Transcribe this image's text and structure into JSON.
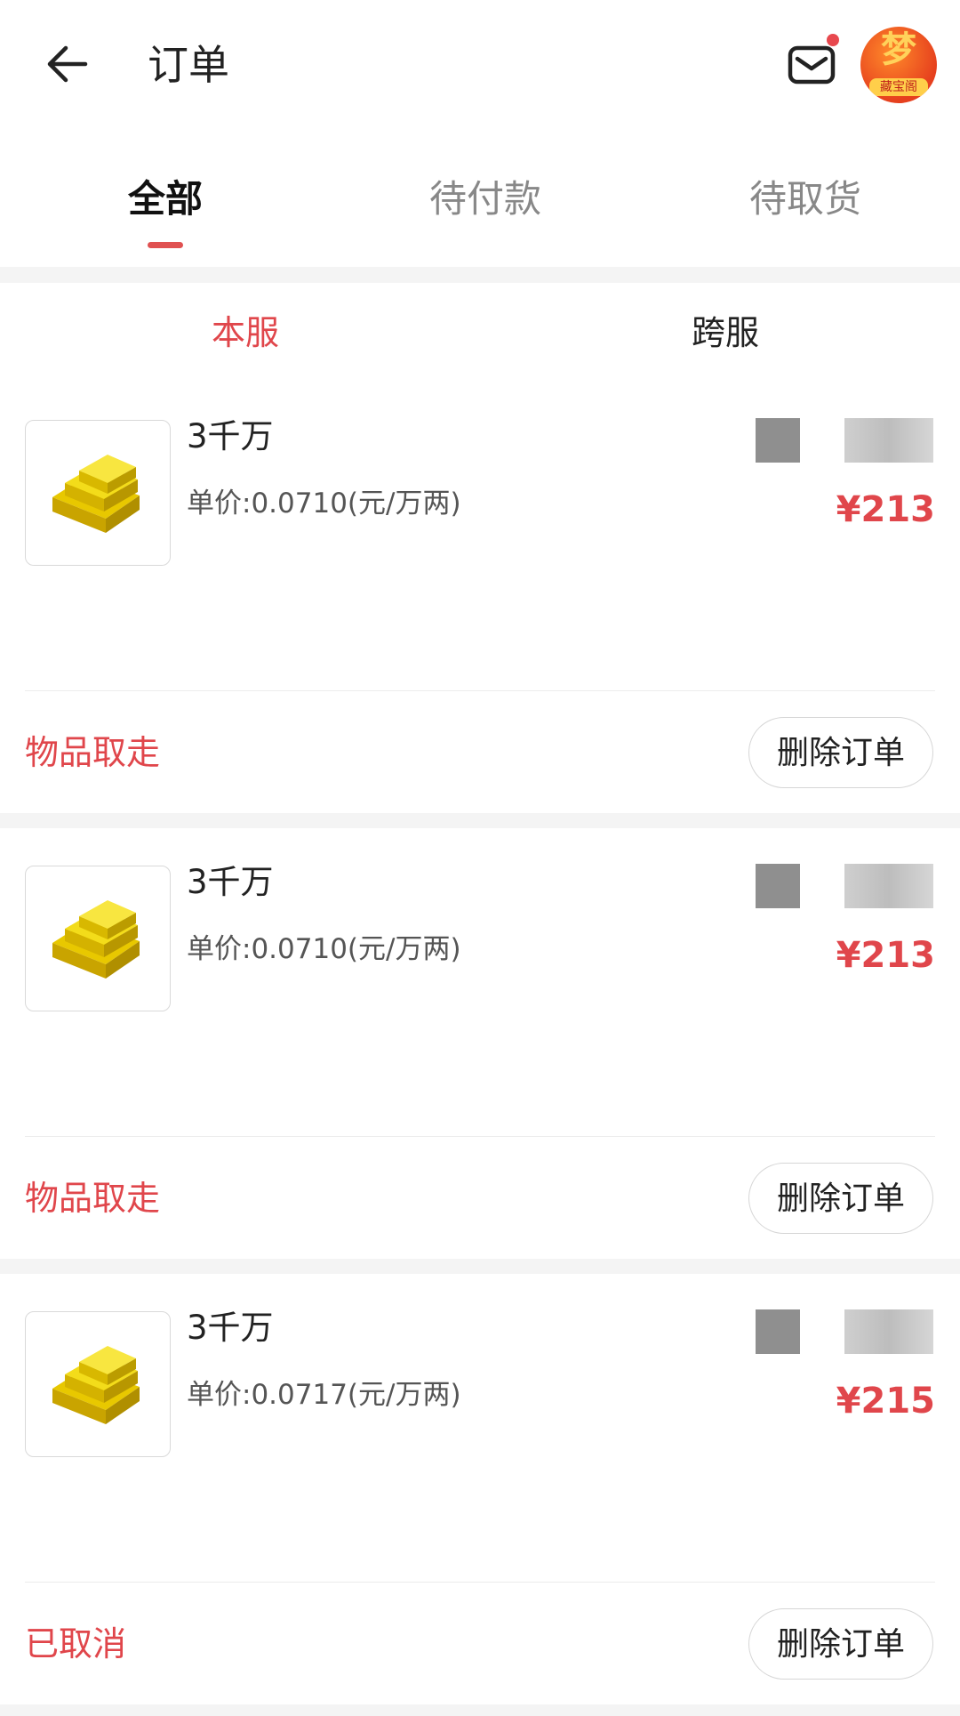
{
  "header": {
    "title": "订单"
  },
  "tabs": [
    {
      "label": "全部",
      "active": true
    },
    {
      "label": "待付款",
      "active": false
    },
    {
      "label": "待取货",
      "active": false
    }
  ],
  "subtabs": [
    {
      "label": "本服",
      "active": true
    },
    {
      "label": "跨服",
      "active": false
    }
  ],
  "avatar": {
    "big": "梦",
    "small": "藏宝阁"
  },
  "orders": [
    {
      "name": "3千万",
      "unit_price": "单价:0.0710(元/万两)",
      "price": "¥213",
      "status": "物品取走",
      "delete_label": "删除订单"
    },
    {
      "name": "3千万",
      "unit_price": "单价:0.0710(元/万两)",
      "price": "¥213",
      "status": "物品取走",
      "delete_label": "删除订单"
    },
    {
      "name": "3千万",
      "unit_price": "单价:0.0717(元/万两)",
      "price": "¥215",
      "status": "已取消",
      "delete_label": "删除订单"
    }
  ],
  "colors": {
    "accent": "#e0464b",
    "background": "#f4f4f4"
  },
  "icons": {
    "back": "arrow-left-icon",
    "mail": "mail-icon",
    "item": "gold-ingot-icon"
  }
}
